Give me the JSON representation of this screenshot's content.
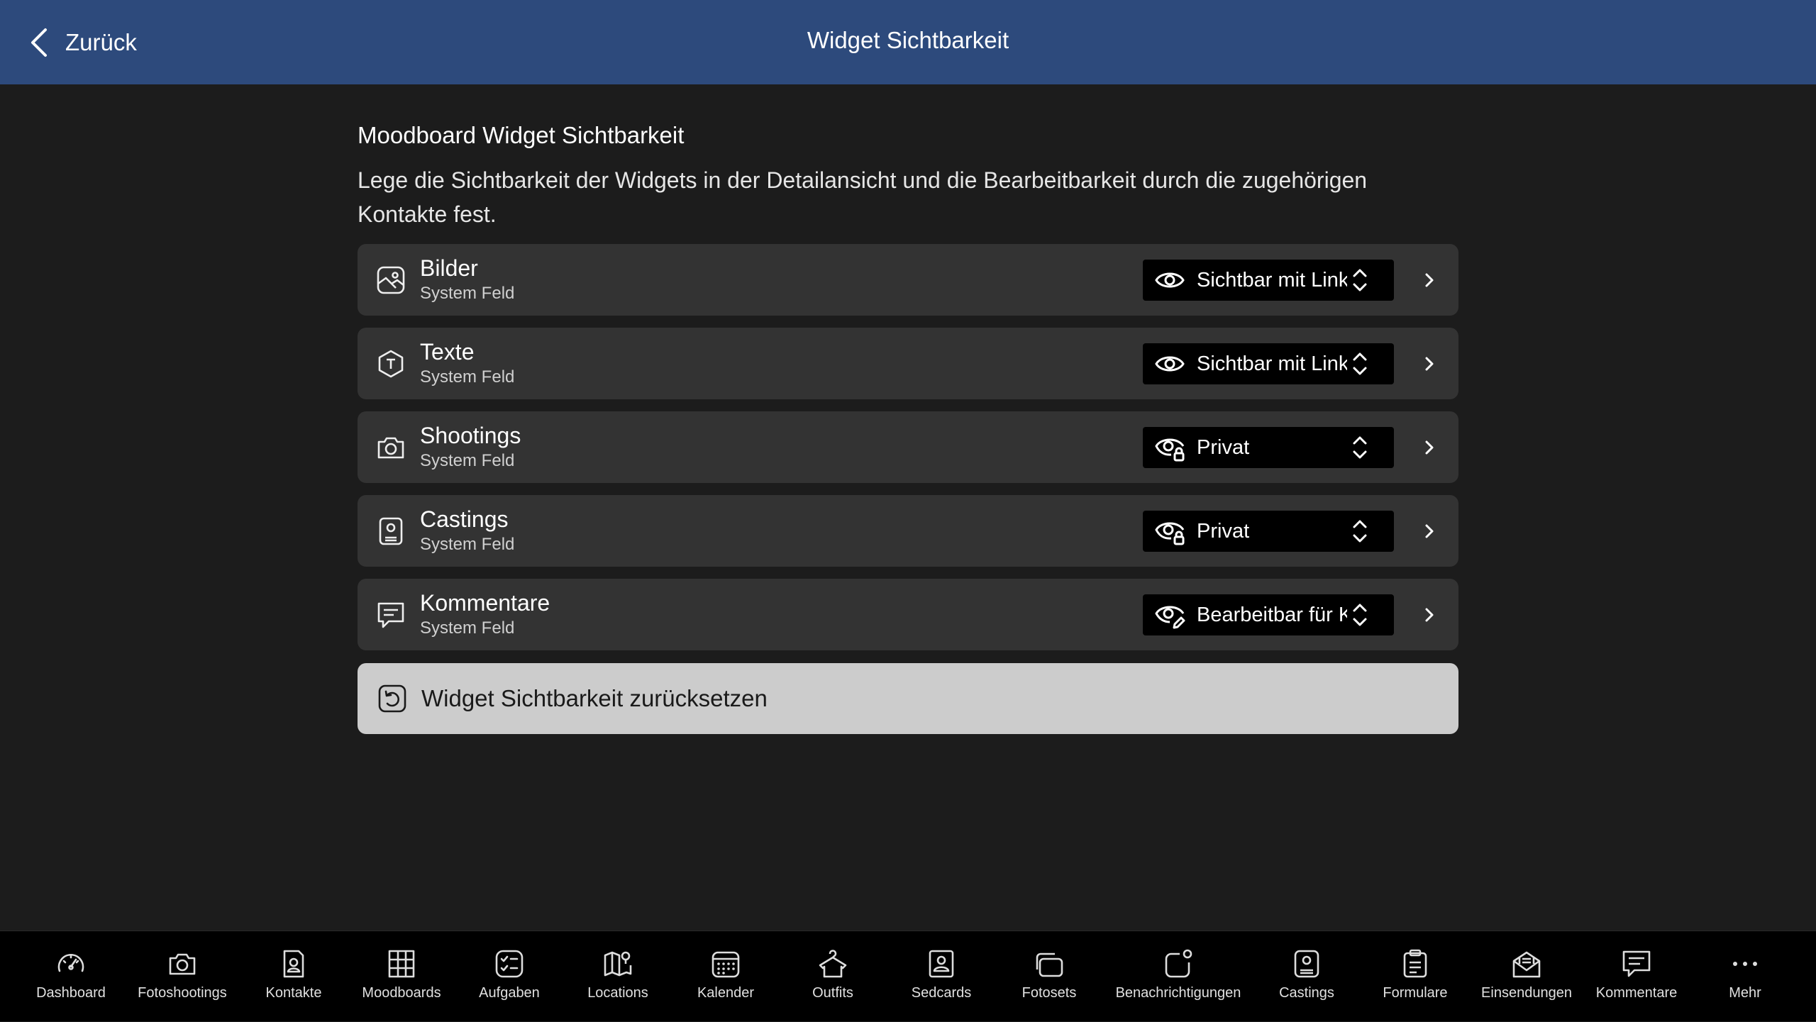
{
  "header": {
    "back_label": "Zurück",
    "title": "Widget Sichtbarkeit"
  },
  "section": {
    "title": "Moodboard Widget Sichtbarkeit",
    "description_line1": "Lege die Sichtbarkeit der Widgets in der Detailansicht und die Bearbeitbarkeit durch die zugehörigen",
    "description_line2": "Kontakte fest."
  },
  "rows": [
    {
      "name": "Bilder",
      "sub": "System Feld",
      "visibility": "Sichtbar mit Link",
      "icon": "image-icon",
      "vis_icon": "eye-icon"
    },
    {
      "name": "Texte",
      "sub": "System Feld",
      "visibility": "Sichtbar mit Link",
      "icon": "text-hexagon-icon",
      "vis_icon": "eye-icon"
    },
    {
      "name": "Shootings",
      "sub": "System Feld",
      "visibility": "Privat",
      "icon": "camera-icon",
      "vis_icon": "eye-lock-icon"
    },
    {
      "name": "Castings",
      "sub": "System Feld",
      "visibility": "Privat",
      "icon": "contact-card-icon",
      "vis_icon": "eye-lock-icon"
    },
    {
      "name": "Kommentare",
      "sub": "System Feld",
      "visibility": "Bearbeitbar für K",
      "icon": "comment-icon",
      "vis_icon": "eye-edit-icon"
    }
  ],
  "reset_label": "Widget Sichtbarkeit zurücksetzen",
  "tabs": [
    {
      "label": "Dashboard",
      "icon": "dashboard-icon"
    },
    {
      "label": "Fotoshootings",
      "icon": "camera-icon"
    },
    {
      "label": "Kontakte",
      "icon": "contact-icon"
    },
    {
      "label": "Moodboards",
      "icon": "moodboard-icon"
    },
    {
      "label": "Aufgaben",
      "icon": "tasks-icon"
    },
    {
      "label": "Locations",
      "icon": "map-icon"
    },
    {
      "label": "Kalender",
      "icon": "calendar-icon"
    },
    {
      "label": "Outfits",
      "icon": "outfit-icon"
    },
    {
      "label": "Sedcards",
      "icon": "sedcard-icon"
    },
    {
      "label": "Fotosets",
      "icon": "photoset-icon"
    },
    {
      "label": "Benachrichtigungen",
      "icon": "notification-icon"
    },
    {
      "label": "Castings",
      "icon": "casting-icon"
    },
    {
      "label": "Formulare",
      "icon": "form-icon"
    },
    {
      "label": "Einsendungen",
      "icon": "submission-icon"
    },
    {
      "label": "Kommentare",
      "icon": "comment-icon"
    },
    {
      "label": "Mehr",
      "icon": "more-icon"
    }
  ]
}
